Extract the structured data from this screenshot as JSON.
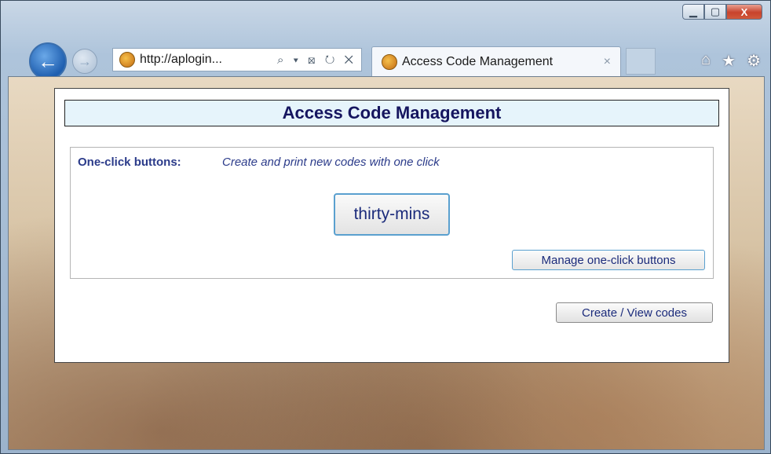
{
  "browser": {
    "address": "http://aplogin...",
    "address_tools": "⌕ ▾ ⊠ ↻ ✕",
    "tab_title": "Access Code Management",
    "tab_close": "×",
    "window_controls": {
      "min": "▁",
      "max": "▢",
      "close": "X"
    },
    "toolbar_icons": {
      "home": "⌂",
      "favorites": "★",
      "settings": "⚙"
    },
    "back": "←",
    "forward": "→"
  },
  "page": {
    "title": "Access Code Management",
    "one_click": {
      "label": "One-click buttons:",
      "description": "Create and print new codes with one click",
      "buttons": [
        "thirty-mins"
      ],
      "manage_label": "Manage one-click buttons"
    },
    "create_view_label": "Create / View codes"
  }
}
